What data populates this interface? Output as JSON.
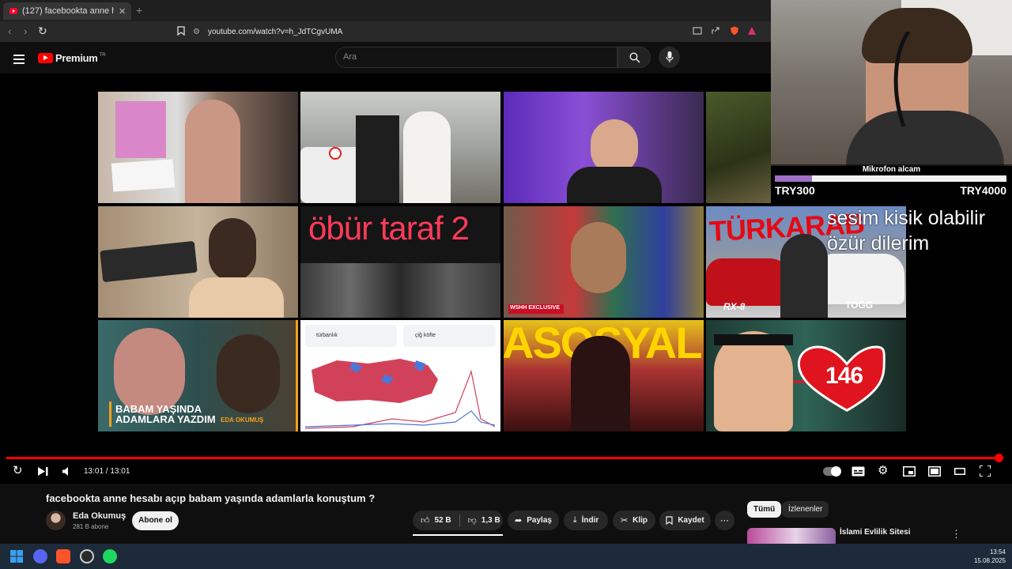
{
  "browser": {
    "tab_title": "(127) facebookta anne he",
    "tab_close": "✕",
    "new_tab": "+",
    "url": "youtube.com/watch?v=h_JdTCgvUMA"
  },
  "youtube": {
    "logo_text": "Premium",
    "logo_region": "TR",
    "search_placeholder": "Ara"
  },
  "end_screen": {
    "thumbnails": [
      {
        "label": ""
      },
      {
        "label": ""
      },
      {
        "label": ""
      },
      {
        "label": ""
      },
      {
        "label": ""
      },
      {
        "label": "öbür taraf 2"
      },
      {
        "label": "WSHH EXCLUSIVE"
      },
      {
        "label": "TÜRKARAB"
      },
      {
        "label": "BABAM YAŞINDA ADAMLARA YAZDIM",
        "sub": "EDA OKUMUŞ"
      },
      {
        "label": "türbanlık",
        "sub": "çiğ köfte"
      },
      {
        "label": "ASOSYAL"
      },
      {
        "label": "146"
      }
    ],
    "extra_labels": {
      "rx8": "RX-8",
      "togg": "TOGG"
    }
  },
  "stream_overlay": {
    "goal_title": "Mikrofon alcam",
    "goal_progress": 0.16,
    "goal_current": "TRY300",
    "goal_target": "TRY4000",
    "note_line1": "sesim kisik olabilir",
    "note_line2": "özür dilerim",
    "accent_color": "#a070c8"
  },
  "player": {
    "time": "13:01 / 13:01",
    "progress": 1.0,
    "progress_color": "#ff0000"
  },
  "video": {
    "title": "facebookta anne hesabı açıp babam yaşında adamlarla konuştum ?",
    "channel": "Eda Okumuş",
    "subscribers": "281 B abone",
    "subscribe_label": "Abone ol",
    "likes": "52 B",
    "dislikes": "1,3 B",
    "share": "Paylaş",
    "download": "İndir",
    "clip": "Klip",
    "save": "Kaydet"
  },
  "sidebar": {
    "chips": [
      "Tümü",
      "İzlenenler"
    ],
    "rec_title": "İslami Evlilik Sitesi"
  },
  "taskbar": {
    "time": "13:54",
    "date": "15.08.2025"
  }
}
